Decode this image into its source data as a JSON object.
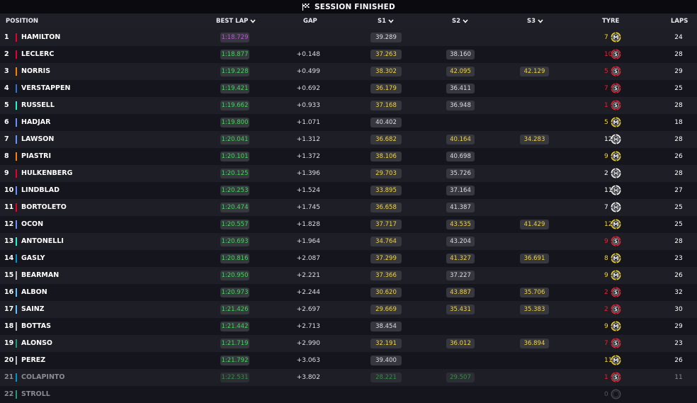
{
  "banner": {
    "title": "SESSION FINISHED",
    "icon": "checkered-flag-icon"
  },
  "columns": {
    "position": "POSITION",
    "best_lap": "BEST LAP",
    "gap": "GAP",
    "s1": "S1",
    "s2": "S2",
    "s3": "S3",
    "tyre": "TYRE",
    "laps": "LAPS"
  },
  "colors": {
    "purple": "#c24fe0",
    "green": "#3adb4f",
    "yellow": "#f2d431",
    "soft": "#e8242e",
    "medium": "#f2d431",
    "hard": "#ffffff"
  },
  "rows": [
    {
      "pos": "1",
      "name": "HAMILTON",
      "team": "#e8002d",
      "best": "1:18.729",
      "best_purple": true,
      "gap": "",
      "s1": "39.289",
      "s1c": "w",
      "s2": "",
      "s2c": "",
      "s3": "",
      "s3c": "",
      "tyre_laps": "7",
      "tyre": "M",
      "laps": "24"
    },
    {
      "pos": "2",
      "name": "LECLERC",
      "team": "#e8002d",
      "best": "1:18.877",
      "gap": "+0.148",
      "s1": "37.263",
      "s1c": "y",
      "s2": "38.160",
      "s2c": "w",
      "s3": "",
      "s3c": "",
      "tyre_laps": "10",
      "tyre": "S",
      "laps": "28"
    },
    {
      "pos": "3",
      "name": "NORRIS",
      "team": "#ff8000",
      "best": "1:19.228",
      "gap": "+0.499",
      "s1": "38.302",
      "s1c": "y",
      "s2": "42.095",
      "s2c": "y",
      "s3": "42.129",
      "s3c": "y",
      "tyre_laps": "5",
      "tyre": "S",
      "laps": "29"
    },
    {
      "pos": "4",
      "name": "VERSTAPPEN",
      "team": "#3671c6",
      "best": "1:19.421",
      "gap": "+0.692",
      "s1": "36.179",
      "s1c": "y",
      "s2": "36.411",
      "s2c": "w",
      "s3": "",
      "s3c": "",
      "tyre_laps": "7",
      "tyre": "S",
      "laps": "25"
    },
    {
      "pos": "5",
      "name": "RUSSELL",
      "team": "#27f4d2",
      "best": "1:19.662",
      "gap": "+0.933",
      "s1": "37.168",
      "s1c": "y",
      "s2": "36.948",
      "s2c": "w",
      "s3": "",
      "s3c": "",
      "tyre_laps": "1",
      "tyre": "S",
      "laps": "28"
    },
    {
      "pos": "6",
      "name": "HADJAR",
      "team": "#6692ff",
      "best": "1:19.800",
      "gap": "+1.071",
      "s1": "40.402",
      "s1c": "w",
      "s2": "",
      "s2c": "",
      "s3": "",
      "s3c": "",
      "tyre_laps": "5",
      "tyre": "M",
      "laps": "18"
    },
    {
      "pos": "7",
      "name": "LAWSON",
      "team": "#6692ff",
      "best": "1:20.041",
      "gap": "+1.312",
      "s1": "36.682",
      "s1c": "y",
      "s2": "40.164",
      "s2c": "y",
      "s3": "34.283",
      "s3c": "y",
      "tyre_laps": "12",
      "tyre": "H",
      "laps": "28"
    },
    {
      "pos": "8",
      "name": "PIASTRI",
      "team": "#ff8000",
      "best": "1:20.101",
      "gap": "+1.372",
      "s1": "38.106",
      "s1c": "y",
      "s2": "40.698",
      "s2c": "w",
      "s3": "",
      "s3c": "",
      "tyre_laps": "9",
      "tyre": "M",
      "laps": "26"
    },
    {
      "pos": "9",
      "name": "HULKENBERG",
      "team": "#e8002d",
      "best": "1:20.125",
      "gap": "+1.396",
      "s1": "29.703",
      "s1c": "y",
      "s2": "35.726",
      "s2c": "w",
      "s3": "",
      "s3c": "",
      "tyre_laps": "2",
      "tyre": "H",
      "laps": "28"
    },
    {
      "pos": "10",
      "name": "LINDBLAD",
      "team": "#6692ff",
      "best": "1:20.253",
      "gap": "+1.524",
      "s1": "33.895",
      "s1c": "y",
      "s2": "37.164",
      "s2c": "w",
      "s3": "",
      "s3c": "",
      "tyre_laps": "11",
      "tyre": "H",
      "laps": "27"
    },
    {
      "pos": "11",
      "name": "BORTOLETO",
      "team": "#e8002d",
      "best": "1:20.474",
      "gap": "+1.745",
      "s1": "36.658",
      "s1c": "y",
      "s2": "41.387",
      "s2c": "w",
      "s3": "",
      "s3c": "",
      "tyre_laps": "7",
      "tyre": "H",
      "laps": "25"
    },
    {
      "pos": "12",
      "name": "OCON",
      "team": "#6692ff",
      "best": "1:20.557",
      "gap": "+1.828",
      "s1": "37.717",
      "s1c": "y",
      "s2": "43.535",
      "s2c": "y",
      "s3": "41.429",
      "s3c": "y",
      "tyre_laps": "12",
      "tyre": "M",
      "laps": "25"
    },
    {
      "pos": "13",
      "name": "ANTONELLI",
      "team": "#27f4d2",
      "best": "1:20.693",
      "gap": "+1.964",
      "s1": "34.764",
      "s1c": "y",
      "s2": "43.204",
      "s2c": "w",
      "s3": "",
      "s3c": "",
      "tyre_laps": "9",
      "tyre": "S",
      "laps": "28"
    },
    {
      "pos": "14",
      "name": "GASLY",
      "team": "#0093cc",
      "best": "1:20.816",
      "gap": "+2.087",
      "s1": "37.299",
      "s1c": "y",
      "s2": "41.327",
      "s2c": "y",
      "s3": "36.691",
      "s3c": "y",
      "tyre_laps": "8",
      "tyre": "M",
      "laps": "23"
    },
    {
      "pos": "15",
      "name": "BEARMAN",
      "team": "#b6babd",
      "best": "1:20.950",
      "gap": "+2.221",
      "s1": "37.366",
      "s1c": "y",
      "s2": "37.227",
      "s2c": "w",
      "s3": "",
      "s3c": "",
      "tyre_laps": "9",
      "tyre": "M",
      "laps": "26"
    },
    {
      "pos": "16",
      "name": "ALBON",
      "team": "#64c4ff",
      "best": "1:20.973",
      "gap": "+2.244",
      "s1": "30.620",
      "s1c": "y",
      "s2": "43.887",
      "s2c": "y",
      "s3": "35.706",
      "s3c": "y",
      "tyre_laps": "2",
      "tyre": "S",
      "laps": "32"
    },
    {
      "pos": "17",
      "name": "SAINZ",
      "team": "#64c4ff",
      "best": "1:21.426",
      "gap": "+2.697",
      "s1": "29.669",
      "s1c": "y",
      "s2": "35.431",
      "s2c": "y",
      "s3": "35.383",
      "s3c": "y",
      "tyre_laps": "2",
      "tyre": "S",
      "laps": "30"
    },
    {
      "pos": "18",
      "name": "BOTTAS",
      "team": "#b6babd",
      "best": "1:21.442",
      "gap": "+2.713",
      "s1": "38.454",
      "s1c": "w",
      "s2": "",
      "s2c": "",
      "s3": "",
      "s3c": "",
      "tyre_laps": "9",
      "tyre": "M",
      "laps": "29"
    },
    {
      "pos": "19",
      "name": "ALONSO",
      "team": "#229971",
      "best": "1:21.719",
      "gap": "+2.990",
      "s1": "32.191",
      "s1c": "y",
      "s2": "36.012",
      "s2c": "y",
      "s3": "36.894",
      "s3c": "y",
      "tyre_laps": "7",
      "tyre": "S",
      "laps": "23"
    },
    {
      "pos": "20",
      "name": "PEREZ",
      "team": "#b6babd",
      "best": "1:21.792",
      "gap": "+3.063",
      "s1": "39.400",
      "s1c": "w",
      "s2": "",
      "s2c": "",
      "s3": "",
      "s3c": "",
      "tyre_laps": "11",
      "tyre": "M",
      "laps": "26"
    },
    {
      "pos": "21",
      "name": "COLAPINTO",
      "team": "#0093cc",
      "best": "1:22.531",
      "gap": "+3.802",
      "s1": "28.221",
      "s1c": "g",
      "s2": "29.507",
      "s2c": "g",
      "s3": "",
      "s3c": "",
      "tyre_laps": "1",
      "tyre": "S",
      "laps": "11",
      "dim": true
    },
    {
      "pos": "22",
      "name": "STROLL",
      "team": "#229971",
      "best": "",
      "gap": "",
      "s1": "",
      "s1c": "",
      "s2": "",
      "s2c": "",
      "s3": "",
      "s3c": "",
      "tyre_laps": "0",
      "tyre": "",
      "laps": "",
      "dim": true
    }
  ]
}
